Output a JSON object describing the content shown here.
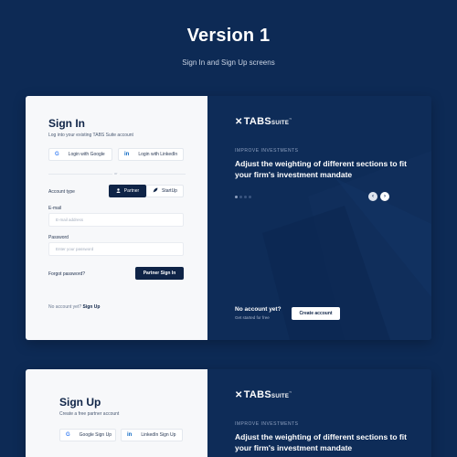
{
  "header": {
    "title": "Version 1",
    "subtitle": "Sign In and Sign Up screens"
  },
  "signin": {
    "title": "Sign In",
    "subtitle": "Log into your existing TABS Suite account",
    "google_label": "Login with Google",
    "linkedin_label": "Login with LinkedIn",
    "or_label": "or",
    "account_type_label": "Account type",
    "type_partner": "Partner",
    "type_startup": "StartUp",
    "email_label": "E-mail",
    "email_placeholder": "E-mail address",
    "password_label": "Password",
    "password_placeholder": "Enter your password",
    "forgot_label": "Forgot password?",
    "submit_label": "Partner Sign In",
    "no_account_text": "No account yet?",
    "no_account_link": "Sign Up"
  },
  "promo": {
    "logo_main": "TABS",
    "logo_suffix": "SUITE",
    "logo_tm": "™",
    "eyebrow": "IMPROVE INVESTMENTS",
    "headline": "Adjust the weighting of different sections to fit your firm's investment mandate",
    "prev_icon": "chevron-left-icon",
    "next_icon": "chevron-right-icon",
    "cta_title": "No account yet?",
    "cta_sub": "Get started for free",
    "cta_button": "Create account"
  },
  "signup": {
    "title": "Sign Up",
    "subtitle": "Create a free partner account",
    "google_label": "Google Sign Up",
    "linkedin_label": "LinkedIn Sign Up"
  },
  "promo2": {
    "logo_main": "TABS",
    "logo_suffix": "SUITE",
    "logo_tm": "™",
    "eyebrow": "IMPROVE INVESTMENTS",
    "headline": "Adjust the weighting of different sections to fit your firm's investment mandate"
  },
  "colors": {
    "background": "#0d2a55",
    "primary": "#0f2447",
    "panel_dark": "#0e2c58"
  }
}
